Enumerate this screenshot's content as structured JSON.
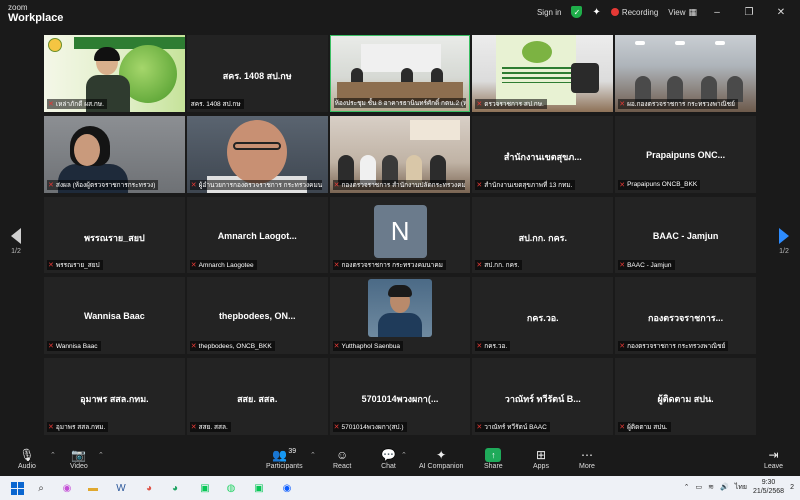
{
  "topbar": {
    "logo_small": "zoom",
    "logo_big": "Workplace",
    "sign_in": "Sign in",
    "recording": "Recording",
    "view": "View",
    "minimize": "–",
    "restore": "❐",
    "close": "✕"
  },
  "tiles": [
    {
      "type": "video",
      "label": "เหล่าภักดี ผส.กษ.",
      "center": ""
    },
    {
      "type": "name",
      "center": "สคร. 1408 สป.กษ",
      "label": "สคร. 1408 สป.กษ"
    },
    {
      "type": "video",
      "label": "ห้องประชุม ชั้น 8 อาคารธานินทร์ศักดิ์ กตน.2 (หลัก)",
      "center": ""
    },
    {
      "type": "video",
      "label": "ตรวจราชการ สป.กษ.",
      "center": ""
    },
    {
      "type": "video",
      "label": "ผอ.กองตรวจราชการ กระทรวงพาณิชย์",
      "center": ""
    },
    {
      "type": "video",
      "label": "ส่งผล (ห้องผู้ตรวจราชการกระทรวง)",
      "center": ""
    },
    {
      "type": "video",
      "label": "ผู้อำนวยการกองตรวจราชการ กระทรวงคมนา...",
      "center": ""
    },
    {
      "type": "video",
      "label": "กองตรวจราชการ สำนักงานปลัดกระทรวงคม...",
      "center": ""
    },
    {
      "type": "name",
      "center": "สำนักงานเขตสุขภ...",
      "label": "สำนักงานเขตสุขภาพที่ 13 กทม."
    },
    {
      "type": "name",
      "center": "Prapaipuns ONC...",
      "label": "Prapaipuns ONCB_BKK"
    },
    {
      "type": "name",
      "center": "พรรณราย_สยป",
      "label": "พรรณราย_สยป"
    },
    {
      "type": "name",
      "center": "Amnarch  Laogot...",
      "label": "Amnarch Laogotee"
    },
    {
      "type": "avatar",
      "initial": "N",
      "label": "กองตรวจราชการ กระทรวงคมนาคม",
      "center": ""
    },
    {
      "type": "name",
      "center": "สป.กก. กคร.",
      "label": "สป.กก. กคร."
    },
    {
      "type": "name",
      "center": "BAAC - Jamjun",
      "label": "BAAC - Jamjun"
    },
    {
      "type": "name",
      "center": "Wannisa Baac",
      "label": "Wannisa Baac"
    },
    {
      "type": "name",
      "center": "thepbodees,  ON...",
      "label": "thepbodees, ONCB_BKK"
    },
    {
      "type": "photo",
      "label": "Yutthaphol Saenbua",
      "center": ""
    },
    {
      "type": "name",
      "center": "กคร.วอ.",
      "label": "กคร.วอ."
    },
    {
      "type": "name",
      "center": "กองตรวจราชการ...",
      "label": "กองตรวจราชการ กระทรวงพาณิชย์"
    },
    {
      "type": "name",
      "center": "อุมาพร สสล.กทม.",
      "label": "อุมาพร สสล.กทม."
    },
    {
      "type": "name",
      "center": "สสย. สสล.",
      "label": "สสย. สสล."
    },
    {
      "type": "name",
      "center": "5701014พวงผกา(...",
      "label": "5701014พวงผกา(สป.)"
    },
    {
      "type": "name",
      "center": "วาณัทร์ ทวีรัตน์  B...",
      "label": "วาณัทร์ ทวีรัตน์ BAAC"
    },
    {
      "type": "name",
      "center": "ผู้ติดตาม สปน.",
      "label": "ผู้ติดตาม สปน."
    }
  ],
  "nav": {
    "left_page": "1/2",
    "right_page": "1/2"
  },
  "toolbar": {
    "audio": "Audio",
    "video": "Video",
    "participants": "Participants",
    "participant_count": "39",
    "react": "React",
    "chat": "Chat",
    "ai_companion": "AI Companion",
    "share": "Share",
    "apps": "Apps",
    "more": "More",
    "leave": "Leave"
  },
  "taskbar": {
    "lang": "ไทย",
    "time": "9:30",
    "date": "21/5/2568",
    "notif": "2"
  },
  "colors": {
    "accent": "#2d8cff",
    "recording": "#e53935",
    "secure": "#1fae4a",
    "active_speaker": "#3bbf64"
  }
}
